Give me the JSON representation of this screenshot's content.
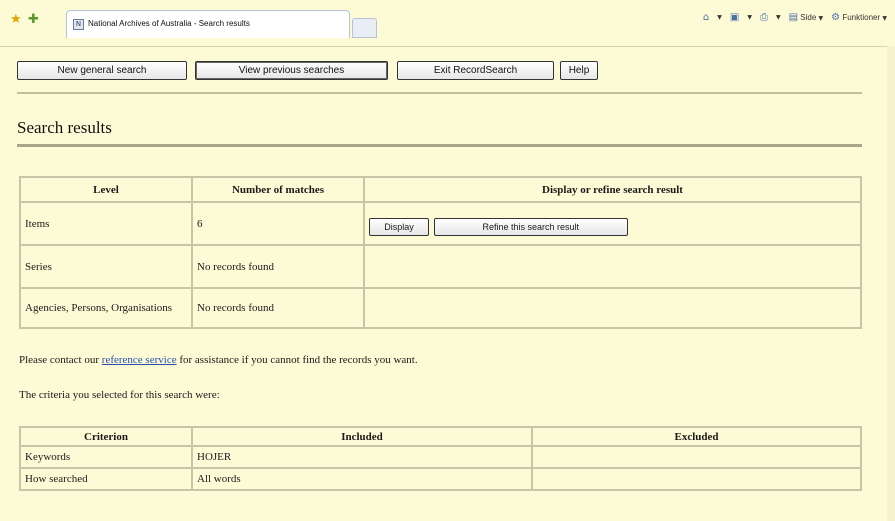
{
  "browser": {
    "tab_title": "National Archives of Australia - Search results",
    "tab_icon_text": "N",
    "commands": {
      "page_label": "Side",
      "tools_label": "Funktioner"
    }
  },
  "toolbar": {
    "new_search": "New general search",
    "previous_searches": "View previous searches",
    "exit": "Exit RecordSearch",
    "help": "Help"
  },
  "page_title": "Search results",
  "results": {
    "headers": [
      "Level",
      "Number of matches",
      "Display or refine search result"
    ],
    "rows": [
      {
        "level": "Items",
        "matches": "6"
      },
      {
        "level": "Series",
        "matches": "No records found"
      },
      {
        "level": "Agencies, Persons, Organisations",
        "matches": "No records found"
      }
    ],
    "display_button": "Display",
    "refine_button": "Refine this search result"
  },
  "contact": {
    "prefix": "Please contact our ",
    "link": "reference service",
    "suffix": " for assistance if you cannot find the records you want."
  },
  "criteria_intro": "The criteria you selected for this search were:",
  "criteria": {
    "headers": [
      "Criterion",
      "Included",
      "Excluded"
    ],
    "rows": [
      {
        "criterion": "Keywords",
        "included": "HOJER",
        "excluded": ""
      },
      {
        "criterion": "How searched",
        "included": "All words",
        "excluded": ""
      }
    ]
  }
}
